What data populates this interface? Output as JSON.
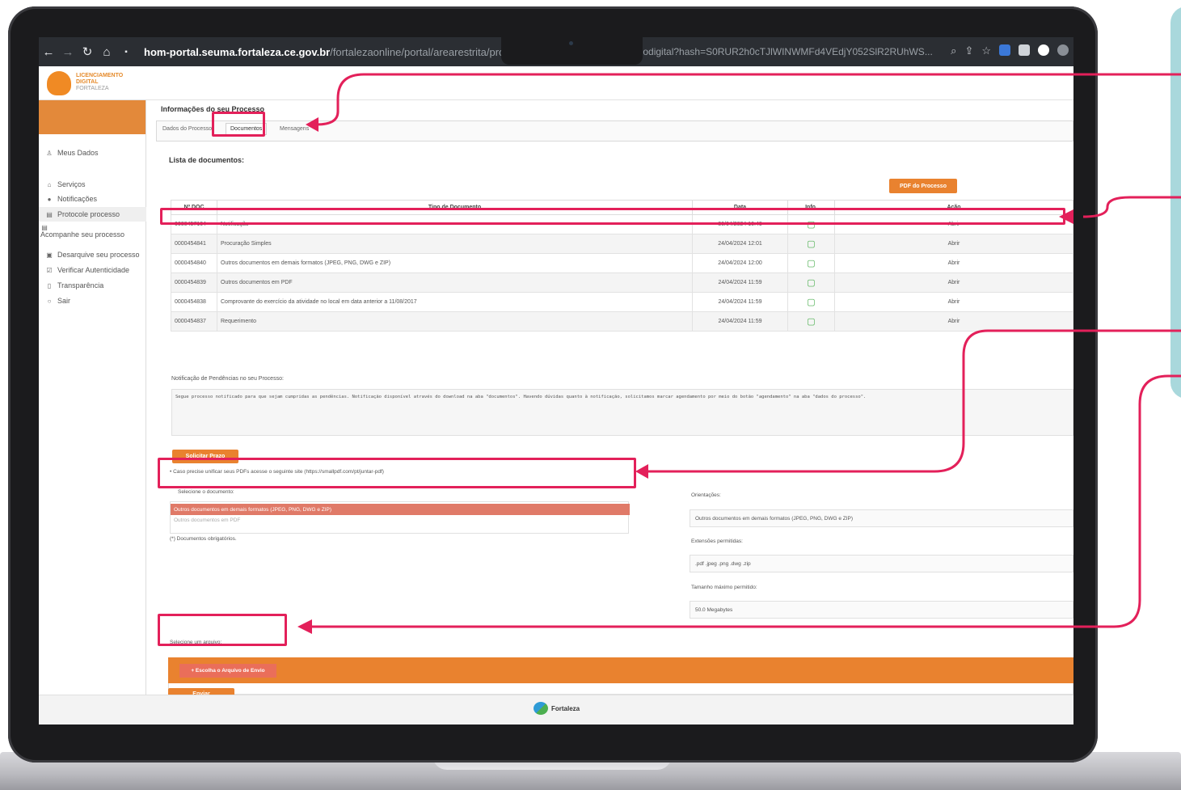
{
  "browser": {
    "url_host": "hom-portal.seuma.fortaleza.ce.gov.br",
    "url_path": "/fortalezaonline/portal/arearestrita/processos",
    "url_tail": "rocessodigital?hash=S0RUR2h0cTJlWINWMFd4VEdjY052SlR2RUhWS..."
  },
  "logo": {
    "line1": "LICENCIAMENTO",
    "line2": "DIGITAL",
    "line3": "FORTALEZA"
  },
  "sidebar": {
    "items": [
      {
        "label": "Meus Dados",
        "icon": "user-icon"
      },
      {
        "label": "Serviços",
        "icon": "home-icon"
      },
      {
        "label": "Notificações",
        "icon": "bell-icon"
      },
      {
        "label": "Protocole processo",
        "icon": "document-icon"
      },
      {
        "label": "Acompanhe seu processo",
        "icon": "document-icon"
      },
      {
        "label": "Desarquive seu processo",
        "icon": "archive-icon"
      },
      {
        "label": "Verificar Autenticidade",
        "icon": "check-icon"
      },
      {
        "label": "Transparência",
        "icon": "file-icon"
      },
      {
        "label": "Sair",
        "icon": "power-icon"
      }
    ]
  },
  "main": {
    "title": "Informações do seu Processo",
    "tabs": [
      "Dados do Processo",
      "Documentos",
      "Mensagens"
    ],
    "docs_title": "Lista de documentos:",
    "pdf_button": "PDF do Processo",
    "table": {
      "headers": [
        "Nº DOC",
        "Tipo de Documento",
        "Data",
        "Info.",
        "Ação"
      ],
      "rows": [
        {
          "num": "0000457164",
          "tipo": "Notificação",
          "data": "30/04/2024 10:49",
          "acao": "Abrir"
        },
        {
          "num": "0000454841",
          "tipo": "Procuração Simples",
          "data": "24/04/2024 12:01",
          "acao": "Abrir"
        },
        {
          "num": "0000454840",
          "tipo": "Outros documentos em demais formatos (JPEG, PNG, DWG e ZIP)",
          "data": "24/04/2024 12:00",
          "acao": "Abrir"
        },
        {
          "num": "0000454839",
          "tipo": "Outros documentos em PDF",
          "data": "24/04/2024 11:59",
          "acao": "Abrir"
        },
        {
          "num": "0000454838",
          "tipo": "Comprovante do exercício da atividade no local em data anterior a 11/08/2017",
          "data": "24/04/2024 11:59",
          "acao": "Abrir"
        },
        {
          "num": "0000454837",
          "tipo": "Requerimento",
          "data": "24/04/2024 11:59",
          "acao": "Abrir"
        }
      ]
    },
    "notif_label": "Notificação de Pendências no seu Processo:",
    "notif_text": "Segue processo notificado para que sejam cumpridas as pendências. Notificação disponível através do download na aba \"documentos\". Havendo dúvidas quanto à notificação, solicitamos marcar agendamento por meio do botão \"agendamento\" na aba \"dados do processo\".",
    "solicitar_prazo": "Solicitar Prazo",
    "hint": "Caso precise unificar seus PDFs acesse o seguinte site (https://smallpdf.com/pt/juntar-pdf)",
    "select_label": "Selecione o documento:",
    "select_options": [
      "Outros documentos em demais formatos (JPEG, PNG, DWG e ZIP)",
      "Outros documentos em PDF"
    ],
    "required_note": "(*) Documentos obrigatórios.",
    "orientacoes_label": "Orientações:",
    "orientacoes_value": "Outros documentos em demais formatos (JPEG, PNG, DWG e ZIP)",
    "extensoes_label": "Extensões permitidas:",
    "extensoes_value": ".pdf .jpeg .png .dwg .zip",
    "tamanho_label": "Tamanho máximo permitido:",
    "tamanho_value": "50.0 Megabytes",
    "arquivo_label": "Selecione um arquivo:",
    "upload_button": "+ Escolha o Arquivo de Envio",
    "enviar_button": "Enviar"
  },
  "footer": {
    "brand": "Fortaleza"
  },
  "colors": {
    "accent": "#e9822f",
    "callout": "#e3205a",
    "selected_option": "#e07a68"
  }
}
